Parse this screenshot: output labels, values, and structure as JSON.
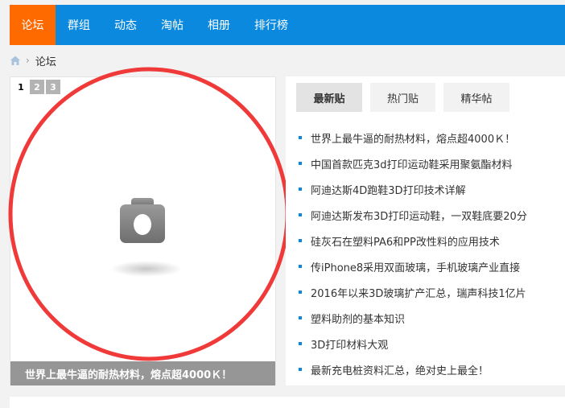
{
  "nav": {
    "items": [
      {
        "label": "论坛",
        "active": true
      },
      {
        "label": "群组"
      },
      {
        "label": "动态"
      },
      {
        "label": "淘帖"
      },
      {
        "label": "相册"
      },
      {
        "label": "排行榜"
      }
    ]
  },
  "breadcrumb": {
    "home_icon": "home-icon",
    "separator": "›",
    "current": "论坛"
  },
  "slider": {
    "pages": [
      "1",
      "2",
      "3"
    ],
    "current_page": "1",
    "placeholder_icon": "camera-icon",
    "caption": "世界上最牛逼的耐热材料，熔点超4000Ｋ！"
  },
  "tabs": [
    "最新贴",
    "热门贴",
    "精华帖"
  ],
  "threads": [
    "世界上最牛逼的耐热材料，熔点超4000Ｋ！",
    "中国首款匹克3d打印运动鞋采用聚氨酯材料",
    "阿迪达斯4D跑鞋3D打印技术详解",
    "阿迪达斯发布3D打印运动鞋，一双鞋底要20分",
    "硅灰石在塑料PA6和PP改性料的应用技术",
    "传iPhone8采用双面玻璃，手机玻璃产业直接",
    "2016年以来3D玻璃扩产汇总，瑞声科技1亿片",
    "塑料助剂的基本知识",
    "3D打印材料大观",
    "最新充电桩资料汇总，绝对史上最全！"
  ],
  "colors": {
    "nav_bg": "#0b89df",
    "nav_active": "#ff6a00",
    "annotation": "#f03a3a"
  }
}
